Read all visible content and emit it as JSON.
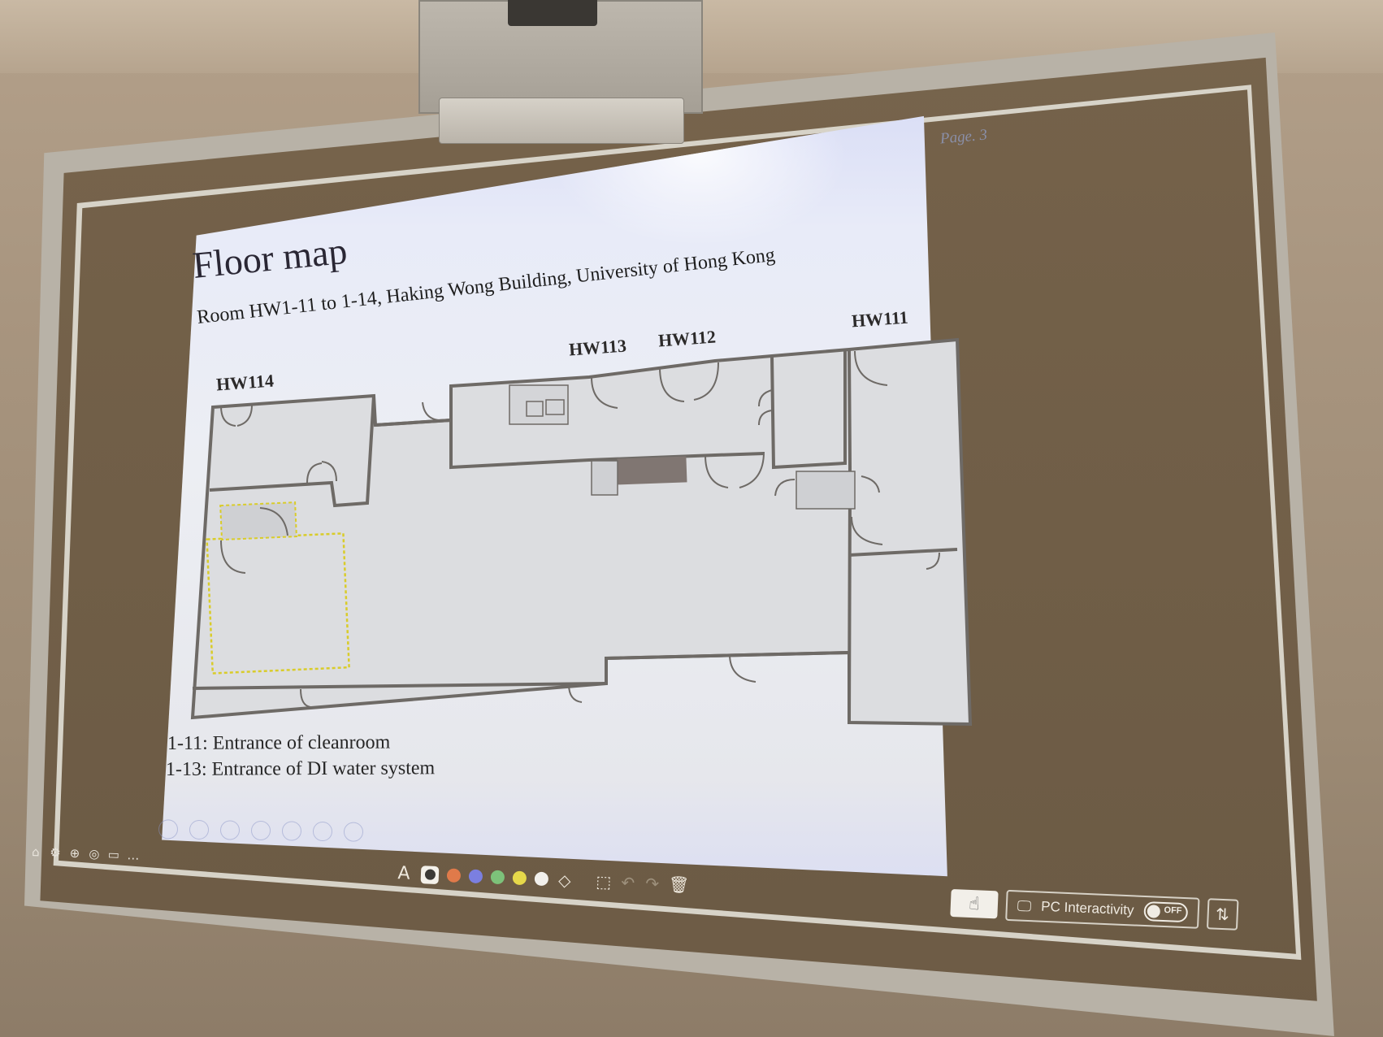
{
  "slide": {
    "page": "Page. 3",
    "title": "Floor map",
    "subtitle": "Room HW1-11 to 1-14, Haking Wong Building, University of Hong Kong",
    "rooms": {
      "hw114": "HW114",
      "hw113": "HW113",
      "hw112": "HW112",
      "hw111": "HW111"
    },
    "notes": [
      "1-11: Entrance of cleanroom",
      "1-13: Entrance of DI water system"
    ]
  },
  "toolbar": {
    "pen_label": "A",
    "pen_colors": [
      "#3c3a36",
      "#e07a4a",
      "#7b7fe0",
      "#7dc27a",
      "#e6d84a",
      "#f2f0ec"
    ],
    "pc_interactivity_label": "PC Interactivity",
    "toggle_state": "OFF"
  },
  "colors": {
    "wall": "#6e6a66",
    "highlight": "#d9cc2a"
  }
}
